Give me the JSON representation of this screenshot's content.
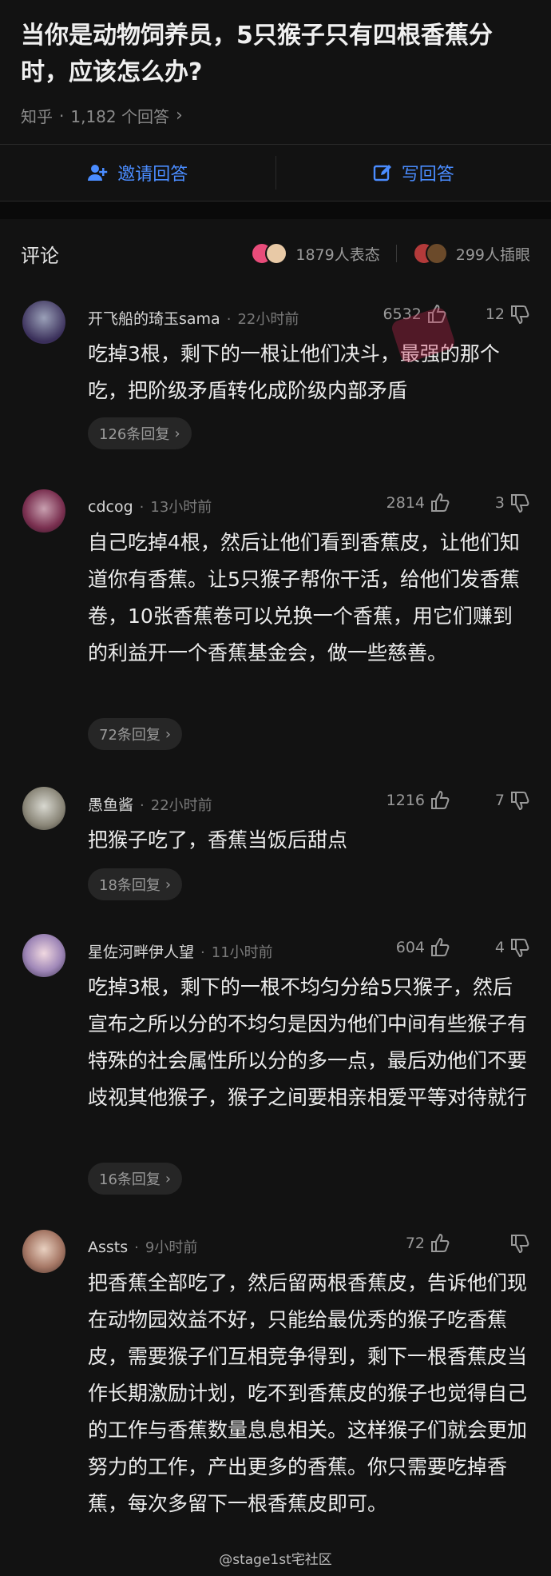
{
  "question": {
    "title": "当你是动物饲养员，5只猴子只有四根香蕉分时，应该怎么办?",
    "source": "知乎",
    "dot": "·",
    "answer_count": "1,182 个回答"
  },
  "actions": {
    "invite": "邀请回答",
    "write": "写回答",
    "accent": "#4a8cff"
  },
  "comments_header": {
    "title": "评论",
    "reactions": "1879人表态",
    "insert_eye": "299人插眼"
  },
  "comments": [
    {
      "user": "开飞船的琦玉sama",
      "dot": "·",
      "time": "22小时前",
      "likes": "6532",
      "dislikes": "12",
      "text": "吃掉3根，剩下的一根让他们决斗，最强的那个吃，把阶级矛盾转化成阶级内部矛盾",
      "replies": "126条回复"
    },
    {
      "user": "cdcog",
      "dot": "·",
      "time": "13小时前",
      "likes": "2814",
      "dislikes": "3",
      "text": "自己吃掉4根，然后让他们看到香蕉皮，让他们知道你有香蕉。让5只猴子帮你干活，给他们发香蕉卷，10张香蕉卷可以兑换一个香蕉，用它们赚到的利益开一个香蕉基金会，做一些慈善。",
      "replies": "72条回复"
    },
    {
      "user": "愚鱼酱",
      "dot": "·",
      "time": "22小时前",
      "likes": "1216",
      "dislikes": "7",
      "text": "把猴子吃了，香蕉当饭后甜点",
      "replies": "18条回复"
    },
    {
      "user": "星佐河畔伊人望",
      "dot": "·",
      "time": "11小时前",
      "likes": "604",
      "dislikes": "4",
      "text": "吃掉3根，剩下的一根不均匀分给5只猴子，然后宣布之所以分的不均匀是因为他们中间有些猴子有特殊的社会属性所以分的多一点，最后劝他们不要歧视其他猴子，猴子之间要相亲相爱平等对待就行",
      "replies": "16条回复"
    },
    {
      "user": "Assts",
      "dot": "·",
      "time": "9小时前",
      "likes": "72",
      "dislikes": "",
      "text": "把香蕉全部吃了，然后留两根香蕉皮，告诉他们现在动物园效益不好，只能给最优秀的猴子吃香蕉皮，需要猴子们互相竞争得到，剩下一根香蕉皮当作长期激励计划，吃不到香蕉皮的猴子也觉得自己的工作与香蕉数量息息相关。这样猴子们就会更加努力的工作，产出更多的香蕉。你只需要吃掉香蕉，每次多留下一根香蕉皮即可。",
      "replies": ""
    }
  ],
  "watermark": "@stage1st宅社区"
}
